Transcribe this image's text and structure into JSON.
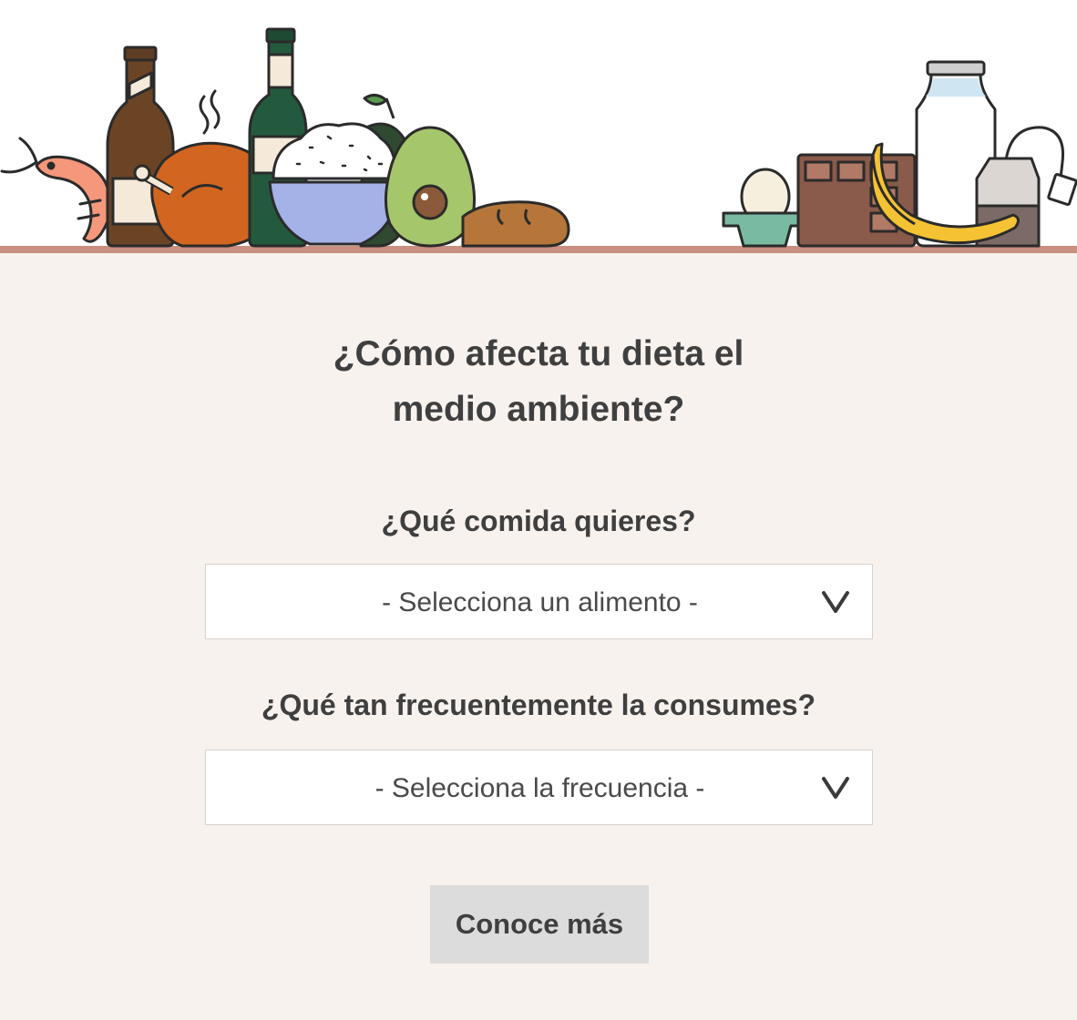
{
  "header": {
    "illustration_items": [
      "shrimp-icon",
      "beer-bottle-icon",
      "roast-chicken-icon",
      "wine-bottle-icon",
      "rice-bowl-icon",
      "avocado-icon",
      "bread-icon",
      "eggs-icon",
      "chocolate-icon",
      "milk-bottle-icon",
      "banana-icon",
      "tea-bag-icon"
    ]
  },
  "main": {
    "title_line1": "¿Cómo afecta tu dieta el",
    "title_line2": "medio ambiente?",
    "food_question": "¿Qué comida quieres?",
    "food_select_value": "- Selecciona un alimento -",
    "frequency_question": "¿Qué tan frecuentemente la consumes?",
    "frequency_select_value": "- Selecciona la frecuencia -",
    "submit_label": "Conoce más"
  },
  "colors": {
    "background": "#f8f2ee",
    "shelf": "#c98f7f",
    "button": "#dcdcdc",
    "text": "#3f3f3f"
  }
}
